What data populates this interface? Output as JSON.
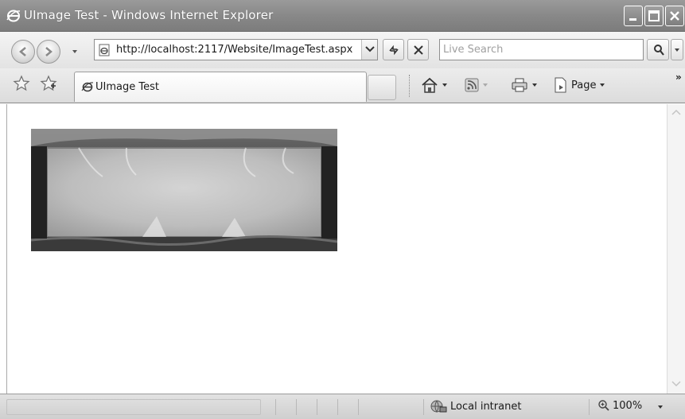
{
  "window": {
    "title": "UImage Test - Windows Internet Explorer",
    "app_icon": "ie-logo-icon"
  },
  "address_bar": {
    "url": "http://localhost:2117/Website/ImageTest.aspx"
  },
  "search": {
    "placeholder": "Live Search"
  },
  "tabs": [
    {
      "label": "UImage Test",
      "icon": "ie-page-icon",
      "active": true
    }
  ],
  "command_bar": {
    "page_label": "Page",
    "overflow": "»"
  },
  "content": {
    "image_alt": "decorative stone frame banner image"
  },
  "status_bar": {
    "zone_label": "Local intranet",
    "zoom_label": "100%"
  },
  "colors": {
    "titlebar": "#8a8a8a",
    "chrome": "#e6e6e6",
    "page": "#ffffff"
  }
}
